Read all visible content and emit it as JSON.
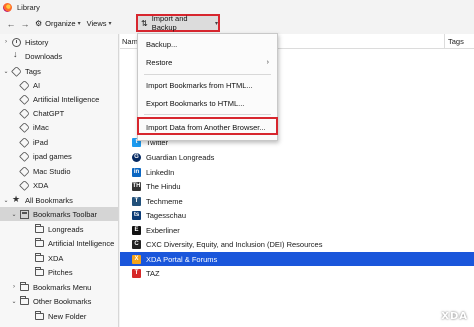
{
  "window": {
    "title": "Library"
  },
  "toolbar": {
    "back_label": "←",
    "forward_label": "→",
    "organize_label": "Organize",
    "views_label": "Views",
    "import_backup_label": "Import and Backup"
  },
  "sidebar": {
    "items": [
      {
        "label": "History",
        "icon": "clock-icon"
      },
      {
        "label": "Downloads",
        "icon": "download-icon"
      },
      {
        "label": "Tags",
        "icon": "tag-icon"
      },
      {
        "label": "AI",
        "icon": "tag-icon"
      },
      {
        "label": "Artificial Intelligence",
        "icon": "tag-icon"
      },
      {
        "label": "ChatGPT",
        "icon": "tag-icon"
      },
      {
        "label": "iMac",
        "icon": "tag-icon"
      },
      {
        "label": "iPad",
        "icon": "tag-icon"
      },
      {
        "label": "ipad games",
        "icon": "tag-icon"
      },
      {
        "label": "Mac Studio",
        "icon": "tag-icon"
      },
      {
        "label": "XDA",
        "icon": "tag-icon"
      },
      {
        "label": "All Bookmarks",
        "icon": "star-icon"
      },
      {
        "label": "Bookmarks Toolbar",
        "icon": "bookmarks-toolbar-icon"
      },
      {
        "label": "Longreads",
        "icon": "folder-icon"
      },
      {
        "label": "Artificial Intelligence",
        "icon": "folder-icon"
      },
      {
        "label": "XDA",
        "icon": "folder-icon"
      },
      {
        "label": "Pitches",
        "icon": "folder-icon"
      },
      {
        "label": "Bookmarks Menu",
        "icon": "folder-icon"
      },
      {
        "label": "Other Bookmarks",
        "icon": "folder-icon"
      },
      {
        "label": "New Folder",
        "icon": "folder-icon"
      }
    ]
  },
  "columns": {
    "name": "Nam",
    "tags": "Tags"
  },
  "bookmarks": [
    {
      "label": "Twitter",
      "color": "#1d9bf0",
      "glyph": "t"
    },
    {
      "label": "Guardian Longreads",
      "color": "#052962",
      "glyph": "G"
    },
    {
      "label": "LinkedIn",
      "color": "#0a66c2",
      "glyph": "in"
    },
    {
      "label": "The Hindu",
      "color": "#333333",
      "glyph": "TH"
    },
    {
      "label": "Techmeme",
      "color": "#22507a",
      "glyph": "T"
    },
    {
      "label": "Tagesschau",
      "color": "#0b3a75",
      "glyph": "ts"
    },
    {
      "label": "Exberliner",
      "color": "#111111",
      "glyph": "E"
    },
    {
      "label": "CXC Diversity, Equity, and Inclusion (DEI) Resources",
      "color": "#222222",
      "glyph": "C"
    },
    {
      "label": "XDA Portal & Forums",
      "color": "#f5a31a",
      "glyph": "X"
    },
    {
      "label": "TAZ",
      "color": "#d62828",
      "glyph": "T"
    }
  ],
  "menu": {
    "backup": "Backup...",
    "restore": "Restore",
    "import_html": "Import Bookmarks from HTML...",
    "export_html": "Export Bookmarks to HTML...",
    "import_browser": "Import Data from Another Browser..."
  },
  "watermark": {
    "text": "XDA"
  },
  "colors": {
    "highlight": "#d7262e",
    "selection": "#1a56db"
  }
}
